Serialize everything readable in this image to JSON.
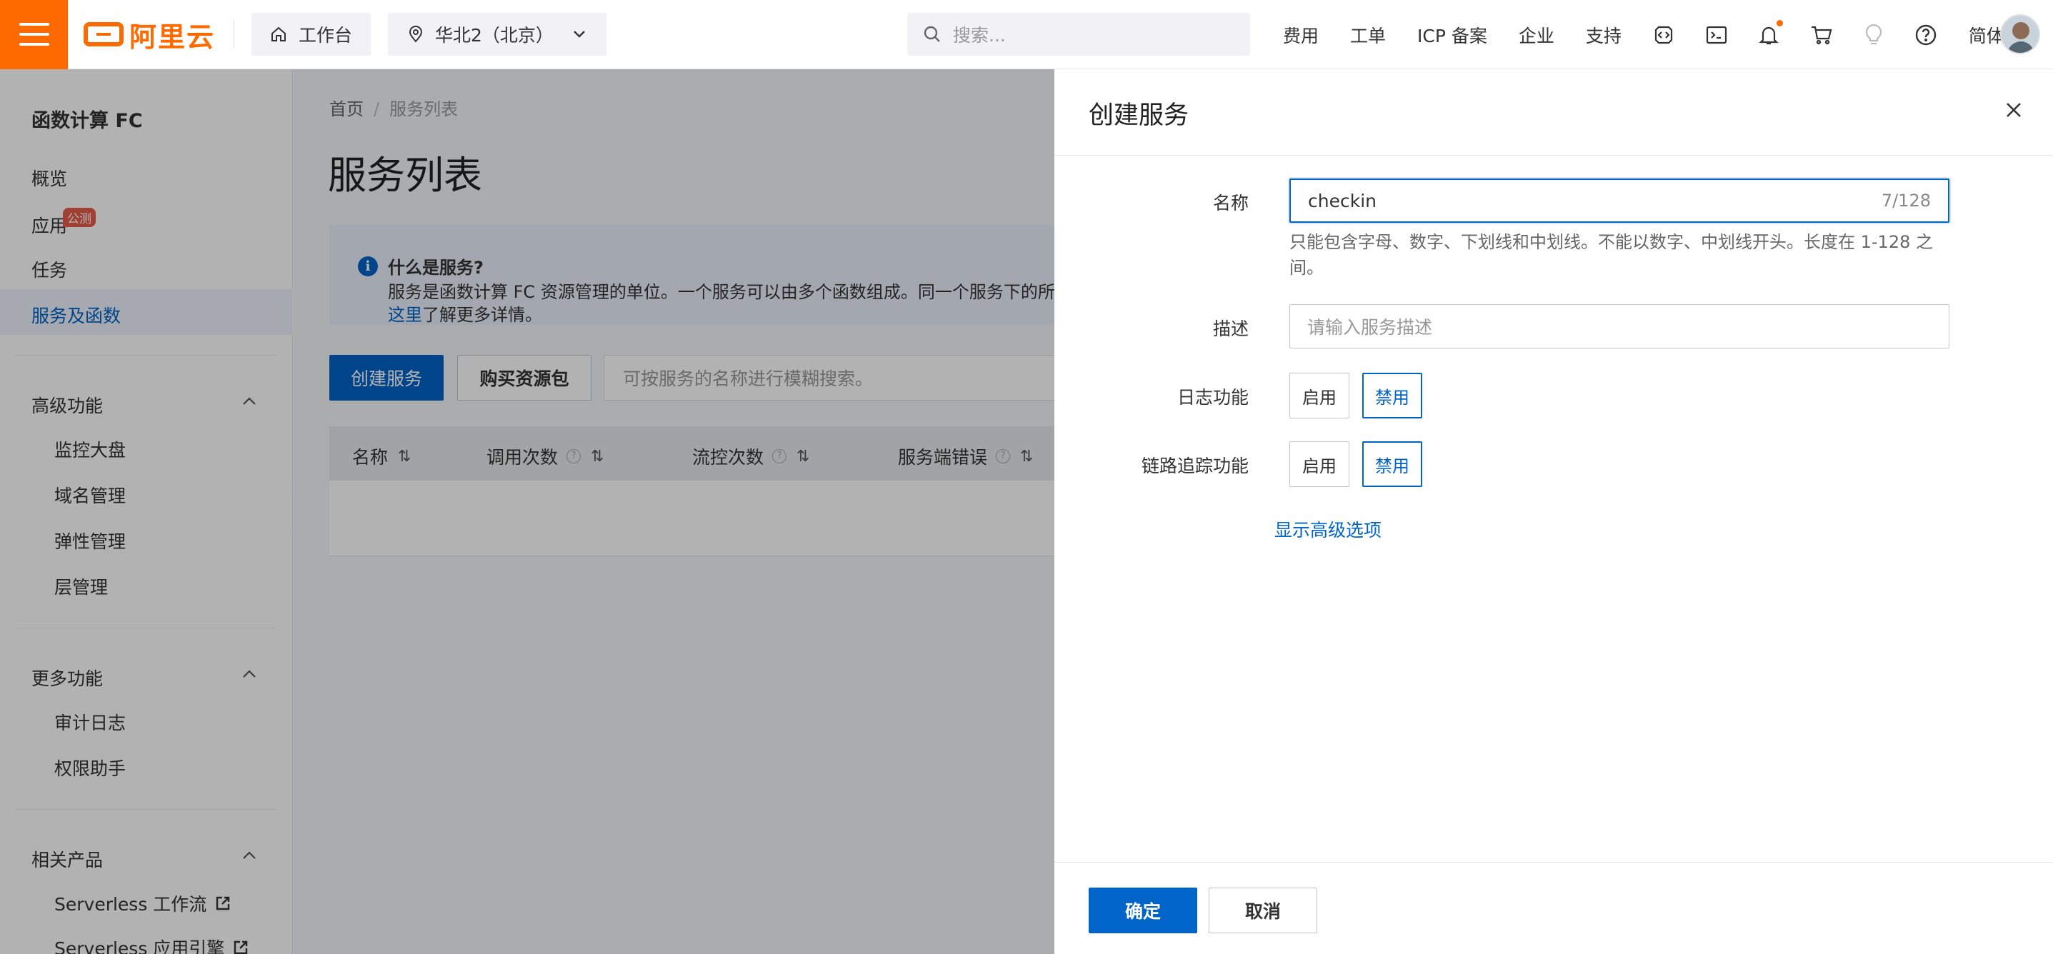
{
  "topbar": {
    "logo_text": "阿里云",
    "workbench": "工作台",
    "region": "华北2（北京）",
    "search_placeholder": "搜索...",
    "links": [
      "费用",
      "工单",
      "ICP 备案",
      "企业",
      "支持"
    ],
    "language": "简体",
    "icons": [
      "code-icon",
      "terminal-icon",
      "bell-icon",
      "cart-icon",
      "lightbulb-icon",
      "help-icon"
    ]
  },
  "sidebar": {
    "title": "函数计算 FC",
    "items": [
      "概览",
      "应用",
      "任务",
      "服务及函数"
    ],
    "badge": "公测",
    "active": "服务及函数",
    "groups": [
      {
        "title": "高级功能",
        "items": [
          "监控大盘",
          "域名管理",
          "弹性管理",
          "层管理"
        ]
      },
      {
        "title": "更多功能",
        "items": [
          "审计日志",
          "权限助手"
        ]
      },
      {
        "title": "相关产品",
        "items": [
          "Serverless 工作流",
          "Serverless 应用引擎"
        ]
      }
    ]
  },
  "main": {
    "breadcrumb": [
      "首页",
      "服务列表"
    ],
    "title": "服务列表",
    "info": {
      "title": "什么是服务?",
      "body": "服务是函数计算 FC 资源管理的单位。一个服务可以由多个函数组成。同一个服务下的所有",
      "link": "这里",
      "link_suffix": "了解更多详情。"
    },
    "create_button": "创建服务",
    "buy_button": "购买资源包",
    "search_placeholder": "可按服务的名称进行模糊搜索。",
    "columns": [
      "名称",
      "调用次数",
      "流控次数",
      "服务端错误"
    ]
  },
  "drawer": {
    "title": "创建服务",
    "name_label": "名称",
    "name_value": "checkin",
    "name_count": "7/128",
    "name_help": "只能包含字母、数字、下划线和中划线。不能以数字、中划线开头。长度在 1-128 之间。",
    "desc_label": "描述",
    "desc_placeholder": "请输入服务描述",
    "log_label": "日志功能",
    "trace_label": "链路追踪功能",
    "enable": "启用",
    "disable": "禁用",
    "log_selected": "禁用",
    "trace_selected": "禁用",
    "advanced": "显示高级选项",
    "ok": "确定",
    "cancel": "取消"
  },
  "colors": {
    "brand": "#ff6a00",
    "primary": "#0064c8",
    "badge": "#e65b4a"
  }
}
